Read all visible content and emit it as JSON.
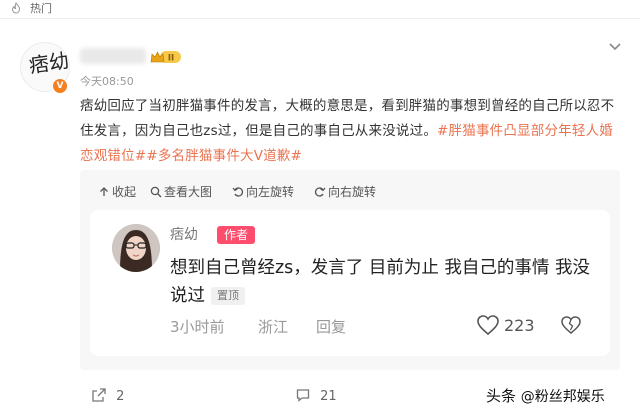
{
  "header": {
    "section_label": "热门"
  },
  "post": {
    "time": "今天08:50",
    "vip_level": "II",
    "verified_mark": "V",
    "avatar_text": "痞幼",
    "body_text": "痞幼回应了当初胖猫事件的发言，大概的意思是，看到胖猫的事想到曾经的自己所以忍不住发言，因为自己也zs过，但是自己的事自己从来没说过。",
    "tags": [
      "#胖猫事件凸显部分年轻人婚恋观错位#",
      "#多名胖猫事件大V道歉#"
    ]
  },
  "image_toolbar": {
    "collapse": "收起",
    "view_large": "查看大图",
    "rotate_left": "向左旋转",
    "rotate_right": "向右旋转"
  },
  "comment": {
    "author": "痞幼",
    "author_badge": "作者",
    "text": "想到自己曾经zs，发言了 目前为止 我自己的事情 我没说过",
    "pinned_label": "置顶",
    "time_ago": "3小时前",
    "location": "浙江",
    "reply_label": "回复",
    "likes": "223"
  },
  "footer": {
    "share_count": "2",
    "comment_count": "21",
    "watermark_source": "头条",
    "watermark_account": "@粉丝邦娱乐"
  },
  "colors": {
    "tag": "#eb7350",
    "author_badge": "#ff4d6d",
    "verified": "#f4801f"
  }
}
